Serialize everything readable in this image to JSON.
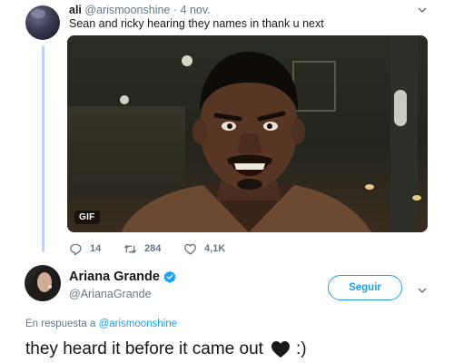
{
  "first_tweet": {
    "display_name": "ali",
    "handle": "@arismoonshine",
    "separator": "·",
    "date": "4 nov.",
    "text": "Sean and ricky hearing they names in thank u next",
    "media_badge": "GIF",
    "actions": {
      "reply_count": "14",
      "retweet_count": "284",
      "like_count": "4,1K"
    }
  },
  "second_tweet": {
    "display_name": "Ariana Grande",
    "verified": true,
    "handle": "@ArianaGrande",
    "follow_label": "Seguir",
    "reply_prefix": "En respuesta a",
    "reply_mention": "@arismoonshine",
    "text_before_emoji": "they heard it before it came out",
    "emoji": "black-heart-icon",
    "text_after_emoji": ":)"
  },
  "colors": {
    "accent": "#1da1f2",
    "muted": "#657786",
    "thread_line": "#c9cdfb"
  }
}
